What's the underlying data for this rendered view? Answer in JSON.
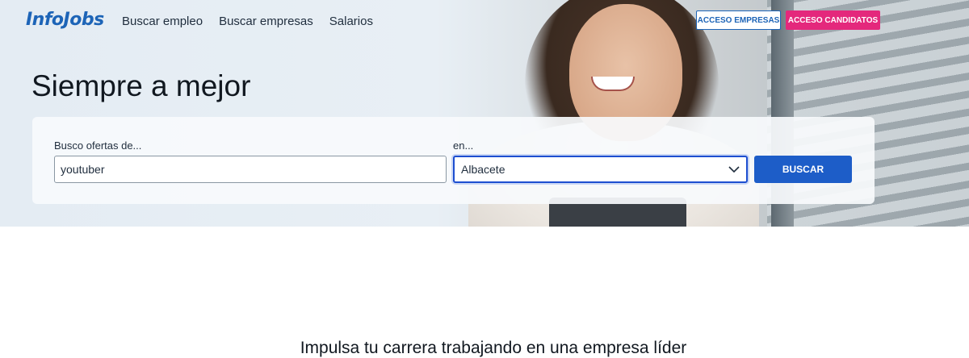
{
  "header": {
    "logo": "InfoJobs",
    "nav": [
      "Buscar empleo",
      "Buscar empresas",
      "Salarios"
    ],
    "btn_empresas": "ACCESO EMPRESAS",
    "btn_candidatos": "ACCESO CANDIDATOS"
  },
  "hero": {
    "title": "Siempre a mejor"
  },
  "search": {
    "what_label": "Busco ofertas de...",
    "what_value": "youtuber",
    "where_label": "en...",
    "where_value": "Albacete",
    "button": "BUSCAR"
  },
  "section": {
    "heading": "Impulsa tu carrera trabajando en una empresa líder"
  },
  "colors": {
    "brand_blue": "#1d64b7",
    "candidate_pink": "#e4287c",
    "search_button": "#1d5dc8"
  },
  "icons": {
    "select_chevron": "chevron-down-icon"
  }
}
